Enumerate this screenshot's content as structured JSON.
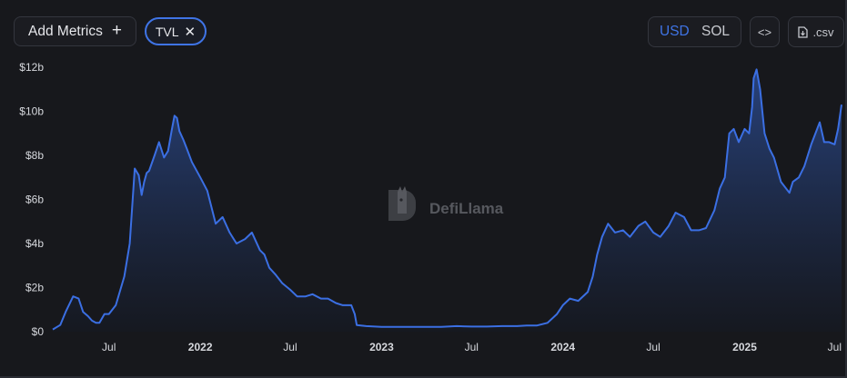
{
  "toolbar": {
    "add_metrics_label": "Add Metrics",
    "add_icon": "plus-icon",
    "tvl_chip_label": "TVL",
    "tvl_chip_close_icon": "close-icon",
    "currency_options": [
      "USD",
      "SOL"
    ],
    "currency_selected": "USD",
    "embed_icon": "code-icon",
    "csv_label": ".csv",
    "csv_icon": "file-download-icon"
  },
  "watermark": {
    "text": "DefiLlama",
    "icon": "llama-logo-icon"
  },
  "colors": {
    "background": "#17181c",
    "line": "#3b6fe3",
    "accent": "#3f74e6",
    "fill_top": "#2b4a8e",
    "fill_bottom": "#151923"
  },
  "chart_data": {
    "type": "area",
    "title": "",
    "xlabel": "",
    "ylabel": "",
    "ylim": [
      0,
      12
    ],
    "y_unit": "USD billions",
    "y_ticks": [
      "$0",
      "$2b",
      "$4b",
      "$6b",
      "$8b",
      "$10b",
      "$12b"
    ],
    "y_tick_values": [
      0,
      2,
      4,
      6,
      8,
      10,
      12
    ],
    "x_ticks": [
      "Jul",
      "2022",
      "Jul",
      "2023",
      "Jul",
      "2024",
      "Jul",
      "2025",
      "Jul"
    ],
    "x_tick_dates": [
      "2021-07-01",
      "2022-01-01",
      "2022-07-01",
      "2023-01-01",
      "2023-07-01",
      "2024-01-01",
      "2024-07-01",
      "2025-01-01",
      "2025-07-01"
    ],
    "x_range": [
      "2021-03-10",
      "2025-07-15"
    ],
    "bold_ticks": [
      "2022",
      "2023",
      "2024",
      "2025"
    ],
    "grid": false,
    "series": [
      {
        "name": "TVL",
        "x": [
          "2021-03-10",
          "2021-03-25",
          "2021-04-05",
          "2021-04-20",
          "2021-05-01",
          "2021-05-10",
          "2021-05-20",
          "2021-05-28",
          "2021-06-05",
          "2021-06-12",
          "2021-06-22",
          "2021-07-01",
          "2021-07-15",
          "2021-08-01",
          "2021-08-12",
          "2021-08-22",
          "2021-08-30",
          "2021-09-05",
          "2021-09-10",
          "2021-09-15",
          "2021-09-20",
          "2021-10-01",
          "2021-10-10",
          "2021-10-20",
          "2021-10-28",
          "2021-11-05",
          "2021-11-10",
          "2021-11-15",
          "2021-11-20",
          "2021-11-28",
          "2021-12-05",
          "2021-12-15",
          "2022-01-01",
          "2022-01-15",
          "2022-02-01",
          "2022-02-15",
          "2022-03-01",
          "2022-03-15",
          "2022-04-01",
          "2022-04-15",
          "2022-05-01",
          "2022-05-10",
          "2022-05-20",
          "2022-06-01",
          "2022-06-15",
          "2022-07-01",
          "2022-07-15",
          "2022-08-01",
          "2022-08-15",
          "2022-09-01",
          "2022-09-15",
          "2022-10-01",
          "2022-10-15",
          "2022-11-01",
          "2022-11-08",
          "2022-11-12",
          "2022-12-01",
          "2023-01-01",
          "2023-02-01",
          "2023-03-01",
          "2023-04-01",
          "2023-05-01",
          "2023-06-01",
          "2023-07-01",
          "2023-08-01",
          "2023-09-01",
          "2023-10-01",
          "2023-10-20",
          "2023-11-10",
          "2023-12-01",
          "2023-12-20",
          "2024-01-01",
          "2024-01-15",
          "2024-02-01",
          "2024-02-20",
          "2024-03-01",
          "2024-03-10",
          "2024-03-20",
          "2024-04-01",
          "2024-04-15",
          "2024-05-01",
          "2024-05-15",
          "2024-06-01",
          "2024-06-15",
          "2024-07-01",
          "2024-07-15",
          "2024-08-01",
          "2024-08-15",
          "2024-09-01",
          "2024-09-15",
          "2024-10-01",
          "2024-10-15",
          "2024-11-01",
          "2024-11-12",
          "2024-11-22",
          "2024-12-01",
          "2024-12-10",
          "2024-12-20",
          "2025-01-01",
          "2025-01-10",
          "2025-01-16",
          "2025-01-19",
          "2025-01-25",
          "2025-02-01",
          "2025-02-10",
          "2025-02-20",
          "2025-03-01",
          "2025-03-15",
          "2025-04-01",
          "2025-04-08",
          "2025-04-20",
          "2025-05-01",
          "2025-05-15",
          "2025-06-01",
          "2025-06-10",
          "2025-06-20",
          "2025-07-01",
          "2025-07-08",
          "2025-07-15"
        ],
        "values": [
          0.1,
          0.3,
          0.9,
          1.6,
          1.5,
          0.9,
          0.7,
          0.5,
          0.4,
          0.4,
          0.8,
          0.8,
          1.2,
          2.5,
          4.0,
          7.4,
          7.1,
          6.2,
          6.8,
          7.2,
          7.3,
          8.0,
          8.6,
          7.9,
          8.2,
          9.2,
          9.8,
          9.7,
          9.1,
          8.7,
          8.3,
          7.7,
          7.0,
          6.4,
          4.9,
          5.2,
          4.5,
          4.0,
          4.2,
          4.5,
          3.7,
          3.5,
          2.9,
          2.6,
          2.2,
          1.9,
          1.6,
          1.6,
          1.7,
          1.5,
          1.5,
          1.3,
          1.2,
          1.2,
          0.8,
          0.3,
          0.25,
          0.22,
          0.22,
          0.22,
          0.22,
          0.22,
          0.25,
          0.23,
          0.23,
          0.25,
          0.25,
          0.28,
          0.28,
          0.4,
          0.8,
          1.2,
          1.5,
          1.4,
          1.8,
          2.5,
          3.5,
          4.3,
          4.9,
          4.5,
          4.6,
          4.3,
          4.8,
          5.0,
          4.5,
          4.3,
          4.8,
          5.4,
          5.2,
          4.6,
          4.6,
          4.7,
          5.5,
          6.5,
          7.0,
          9.0,
          9.2,
          8.6,
          9.2,
          9.0,
          10.2,
          11.5,
          11.9,
          11.0,
          9.0,
          8.3,
          7.9,
          6.8,
          6.3,
          6.8,
          7.0,
          7.5,
          8.5,
          9.5,
          8.6,
          8.6,
          8.5,
          9.2,
          10.3
        ]
      }
    ]
  }
}
